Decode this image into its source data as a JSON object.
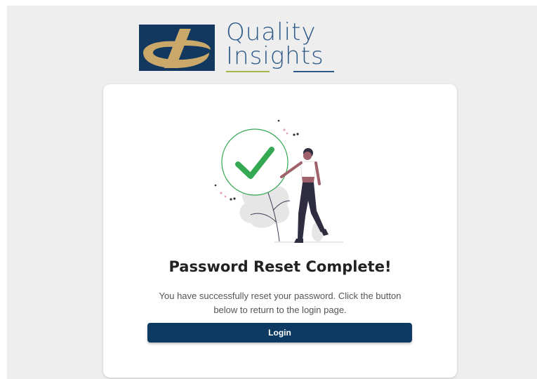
{
  "logo": {
    "line1": "Quality",
    "line2": "Insights"
  },
  "card": {
    "title": "Password Reset Complete!",
    "message": "You have successfully reset your password. Click the button below to return to the login page.",
    "login_label": "Login"
  },
  "colors": {
    "brand_navy": "#0d3a63",
    "logo_blue": "#2e5a88",
    "logo_gold": "#c9a86a",
    "logo_green": "#a7b44a",
    "check_green": "#34a853",
    "background": "#eeeeee"
  },
  "icons": {
    "logo_mark": "quality-insights-logo-mark",
    "illustration": "success-checkmark-person-illustration"
  }
}
